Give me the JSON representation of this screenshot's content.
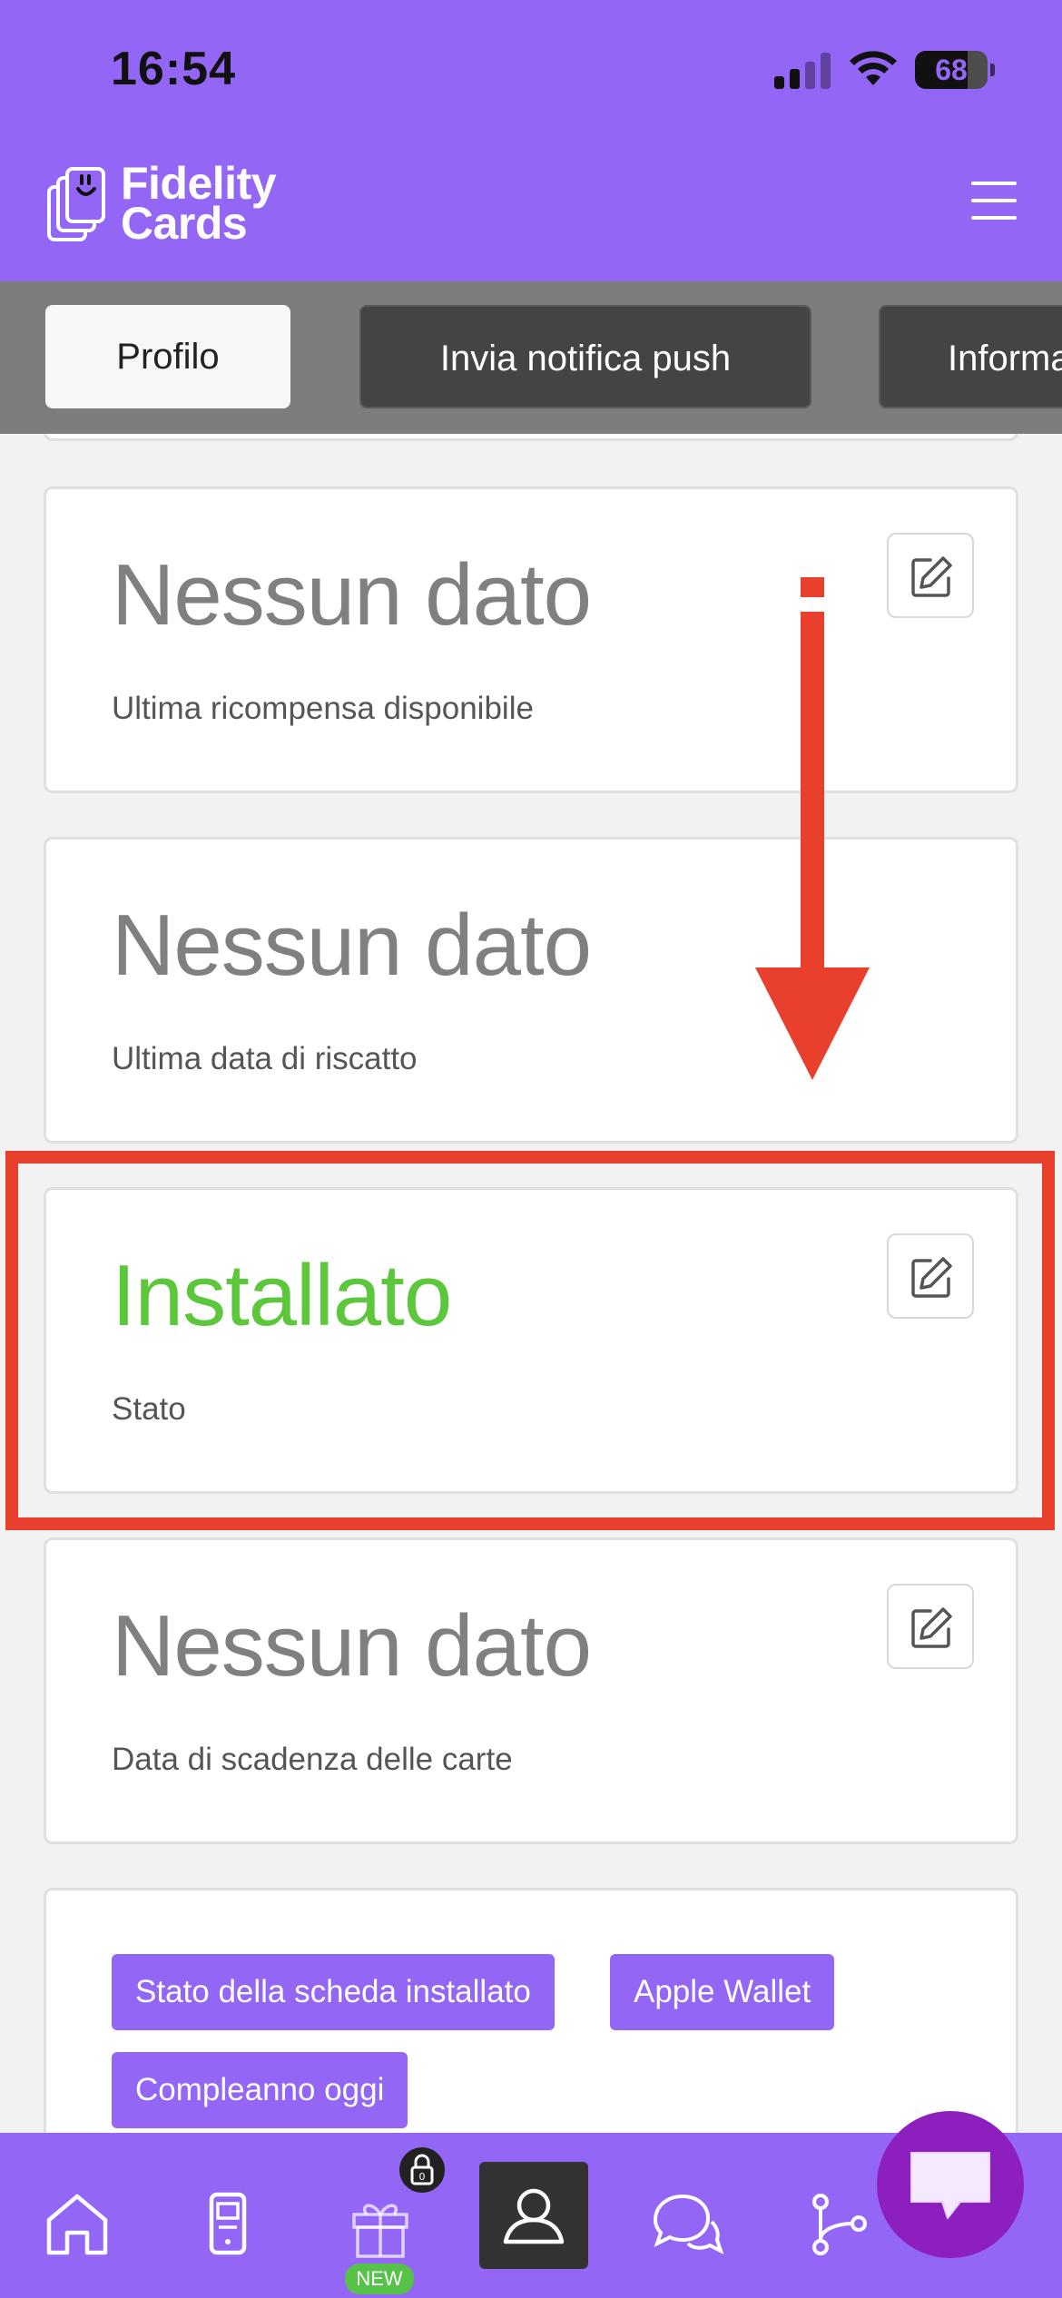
{
  "status_bar": {
    "time": "16:54",
    "battery": "68"
  },
  "header": {
    "logo_line1": "Fidelity",
    "logo_line2": "Cards"
  },
  "tabs": [
    {
      "label": "Profilo",
      "active": true
    },
    {
      "label": "Invia notifica push",
      "active": false
    },
    {
      "label": "Informa",
      "active": false
    }
  ],
  "cards": [
    {
      "value": "Nessun dato",
      "label": "Ultima ricompensa disponibile",
      "editable": true
    },
    {
      "value": "Nessun dato",
      "label": "Ultima data di riscatto",
      "editable": false
    },
    {
      "value": "Installato",
      "label": "Stato",
      "editable": true
    },
    {
      "value": "Nessun dato",
      "label": "Data di scadenza delle carte",
      "editable": true
    }
  ],
  "tags": [
    "Stato della scheda installato",
    "Apple Wallet",
    "Compleanno oggi"
  ],
  "bottom_nav": {
    "items": [
      "home-icon",
      "phone-card-icon",
      "gift-icon",
      "user-profile-icon",
      "chat-bubbles-icon",
      "flow-icon"
    ],
    "active_index": 3,
    "new_badge": "NEW",
    "lock_badge_count": "0"
  },
  "colors": {
    "brand": "#9466f5",
    "status_green": "#5dc73c",
    "annotation_red": "#e8402d",
    "fab": "#8e1fbf"
  }
}
